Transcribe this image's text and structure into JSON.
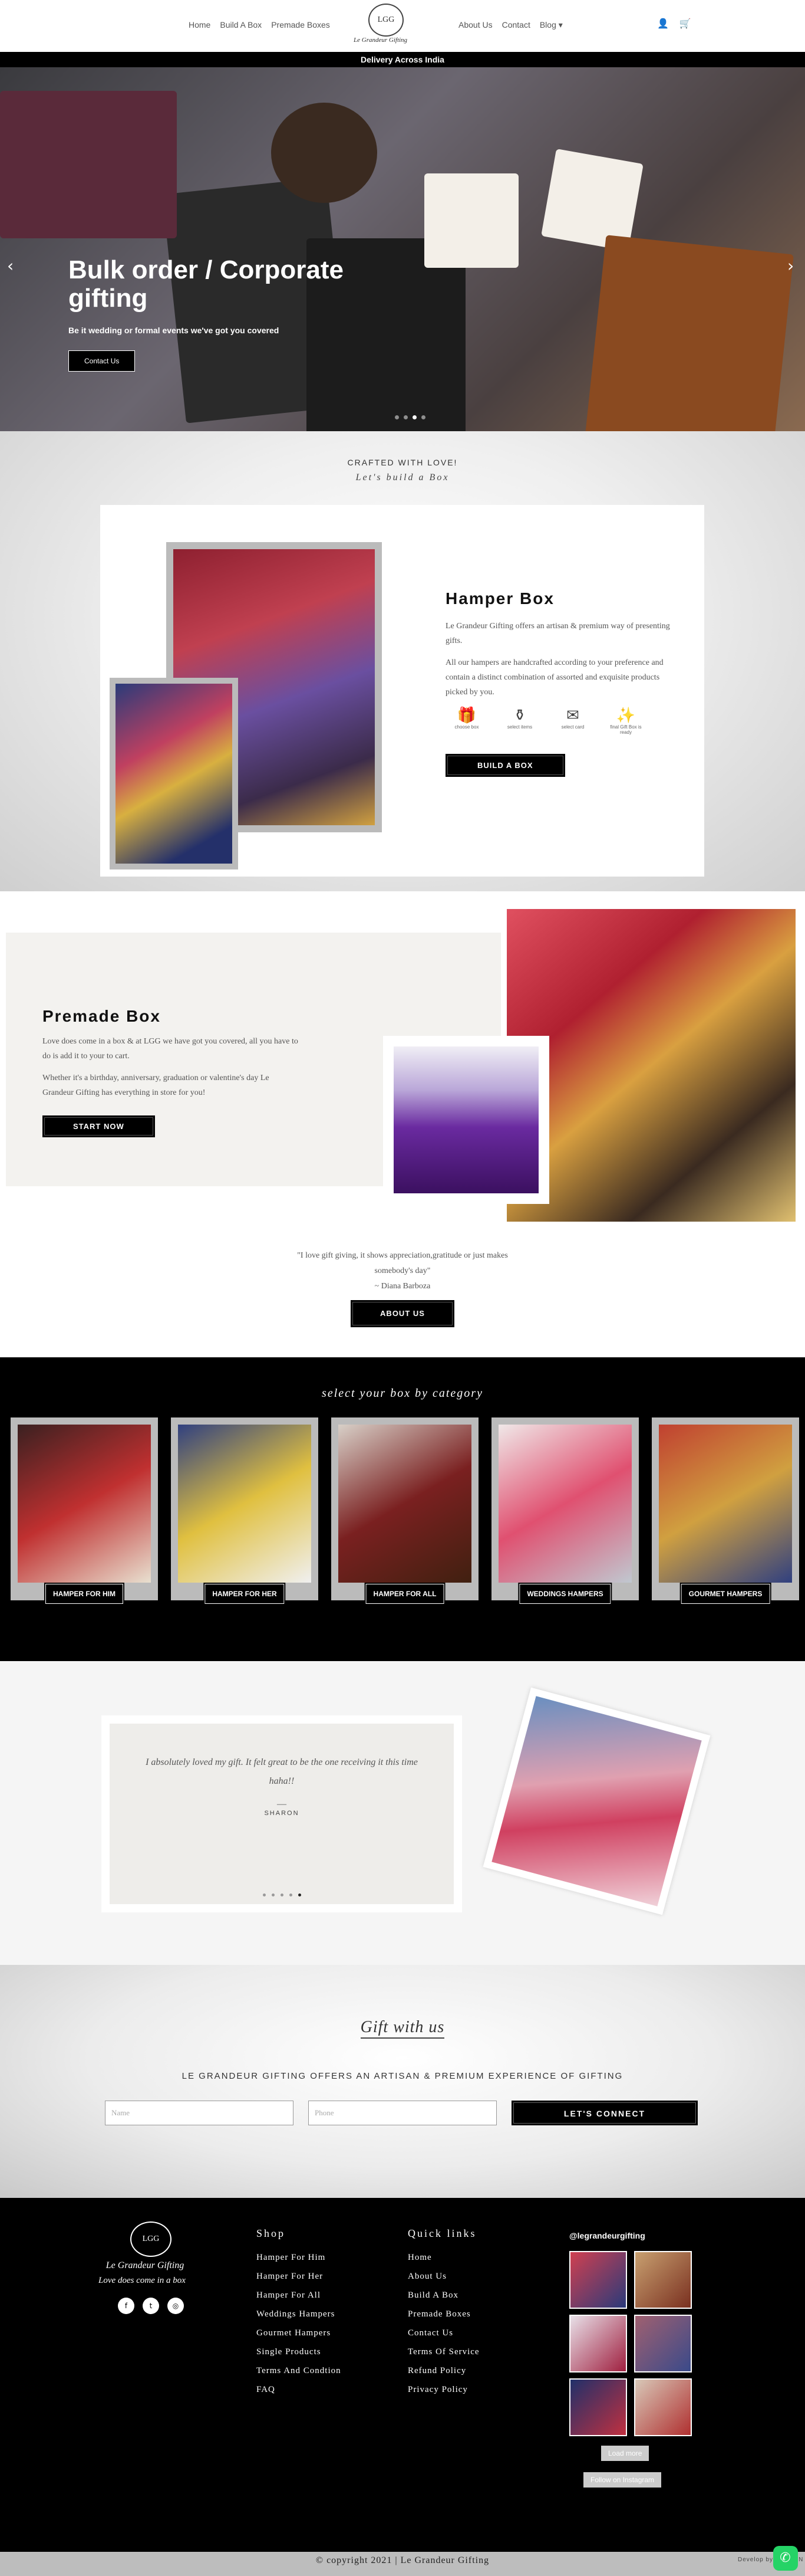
{
  "header": {
    "nav_left": [
      "Home",
      "Build A Box",
      "Premade Boxes"
    ],
    "nav_right": [
      "About Us",
      "Contact",
      "Blog"
    ],
    "logo_text": "Le Grandeur Gifting",
    "logo_mark": "LGG",
    "delivery_bar": "Delivery Across India"
  },
  "hero": {
    "title": "Bulk order / Corporate gifting",
    "subtitle": "Be it wedding or formal events we've got you covered",
    "button": "Contact Us",
    "slide_active": 3,
    "slide_count": 4
  },
  "hamper": {
    "crafted": "CRAFTED WITH LOVE!",
    "lets_build": "Let's build a Box",
    "title": "Hamper Box",
    "para1": "Le Grandeur Gifting offers an artisan & premium way of presenting gifts.",
    "para2": "All our hampers are handcrafted according to your preference and contain a distinct combination of assorted and exquisite products picked by you.",
    "features": [
      {
        "icon": "gift-box-icon",
        "label": "choose box"
      },
      {
        "icon": "jar-icon",
        "label": "select items"
      },
      {
        "icon": "card-icon",
        "label": "select card"
      },
      {
        "icon": "sparkle-gift-icon",
        "label": "final Gift Box is ready"
      }
    ],
    "button": "BUILD A BOX"
  },
  "premade": {
    "title": "Premade Box",
    "para1": "Love does come in a box & at LGG we have got you covered, all you have to do is add it to your to cart.",
    "para2": "Whether it's a birthday, anniversary, graduation or valentine's day Le Grandeur Gifting has everything in store for you!",
    "button": "START NOW",
    "quote": "\"I love gift giving, it shows appreciation,gratitude or just makes somebody's day\"",
    "author": "~ Diana Barboza",
    "about_button": "ABOUT US"
  },
  "categories": {
    "heading": "select your box by category",
    "items": [
      {
        "label": "HAMPER FOR HIM",
        "colors": [
          "#3a2020",
          "#c03030",
          "#e8e0d0"
        ]
      },
      {
        "label": "HAMPER FOR HER",
        "colors": [
          "#304080",
          "#e0c040",
          "#f0f0f0"
        ]
      },
      {
        "label": "HAMPER FOR ALL",
        "colors": [
          "#d8d0c8",
          "#7a2020",
          "#402010"
        ]
      },
      {
        "label": "WEDDINGS HAMPERS",
        "colors": [
          "#f0e8e8",
          "#e05070",
          "#c0c8d0"
        ]
      },
      {
        "label": "GOURMET HAMPERS",
        "colors": [
          "#c04030",
          "#d0a040",
          "#304080"
        ]
      }
    ]
  },
  "testimonial": {
    "text": "I absolutely loved my gift. It felt great to be the one receiving it this time haha!!",
    "dash": "—",
    "name": "SHARON",
    "dots": 5,
    "active_dot": 5
  },
  "gift": {
    "heading": "Gift with us",
    "sub": "LE GRANDEUR GIFTING OFFERS AN ARTISAN & PREMIUM EXPERIENCE OF GIFTING",
    "name_placeholder": "Name",
    "phone_placeholder": "Phone",
    "button": "LET'S CONNECT"
  },
  "footer": {
    "brand": "Le Grandeur Gifting",
    "tagline": "Love does come in a box",
    "social": [
      "facebook-icon",
      "twitter-icon",
      "instagram-icon"
    ],
    "shop_title": "Shop",
    "shop": [
      "Hamper For Him",
      "Hamper For Her",
      "Hamper For All",
      "Weddings Hampers",
      "Gourmet Hampers",
      "Single Products",
      "Terms And Condtion",
      "FAQ"
    ],
    "quick_title": "Quick links",
    "quick": [
      "Home",
      "About Us",
      "Build A Box",
      "Premade Boxes",
      "Contact Us",
      "Terms Of Service",
      "Refund Policy",
      "Privacy Policy"
    ],
    "ig_handle": "@legrandeurgifting",
    "load_more": "Load more",
    "follow": "Follow on Instagram",
    "copyright": "© copyright 2021 | Le Grandeur Gifting",
    "develop": "Develop by XcelZON"
  }
}
